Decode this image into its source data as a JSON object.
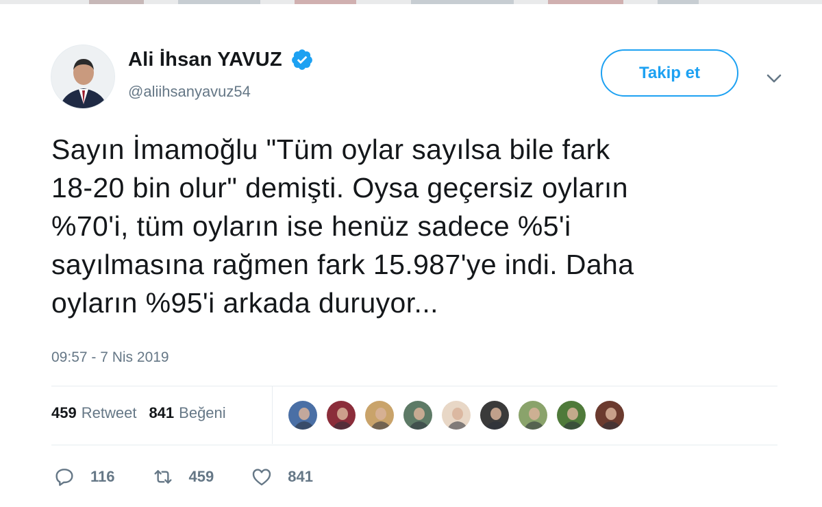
{
  "author": {
    "display_name": "Ali İhsan YAVUZ",
    "handle": "@aliihsanyavuz54",
    "verified": true,
    "avatar_icon": "profile-photo"
  },
  "follow_button": {
    "label": "Takip et"
  },
  "menu": {
    "icon": "chevron-down-icon"
  },
  "tweet": {
    "lines": [
      "Sayın İmamoğlu \"Tüm oylar sayılsa bile fark",
      "18-20 bin olur\" demişti. Oysa geçersiz oyların",
      "%70'i, tüm oyların ise henüz sadece %5'i",
      "sayılmasına rağmen fark 15.987'ye indi. Daha",
      "oyların %95'i arkada duruyor..."
    ],
    "timestamp": "09:57 - 7 Nis 2019"
  },
  "stats": {
    "retweets": {
      "count": "459",
      "label": "Retweet"
    },
    "likes": {
      "count": "841",
      "label": "Beğeni"
    }
  },
  "likers": [
    {
      "color": "#4a6fa5"
    },
    {
      "color": "#8b2d3a"
    },
    {
      "color": "#c9a36a"
    },
    {
      "color": "#5d7a66"
    },
    {
      "color": "#e8d7c6"
    },
    {
      "color": "#3a3a3a"
    },
    {
      "color": "#8aa36b"
    },
    {
      "color": "#4f7a3a"
    },
    {
      "color": "#6b3a2e"
    }
  ],
  "actions": {
    "reply": {
      "icon": "reply-icon",
      "count": "116"
    },
    "retweet": {
      "icon": "retweet-icon",
      "count": "459"
    },
    "like": {
      "icon": "heart-icon",
      "count": "841"
    }
  },
  "colors": {
    "accent": "#1da1f2",
    "muted": "#657786",
    "text": "#14171a"
  }
}
